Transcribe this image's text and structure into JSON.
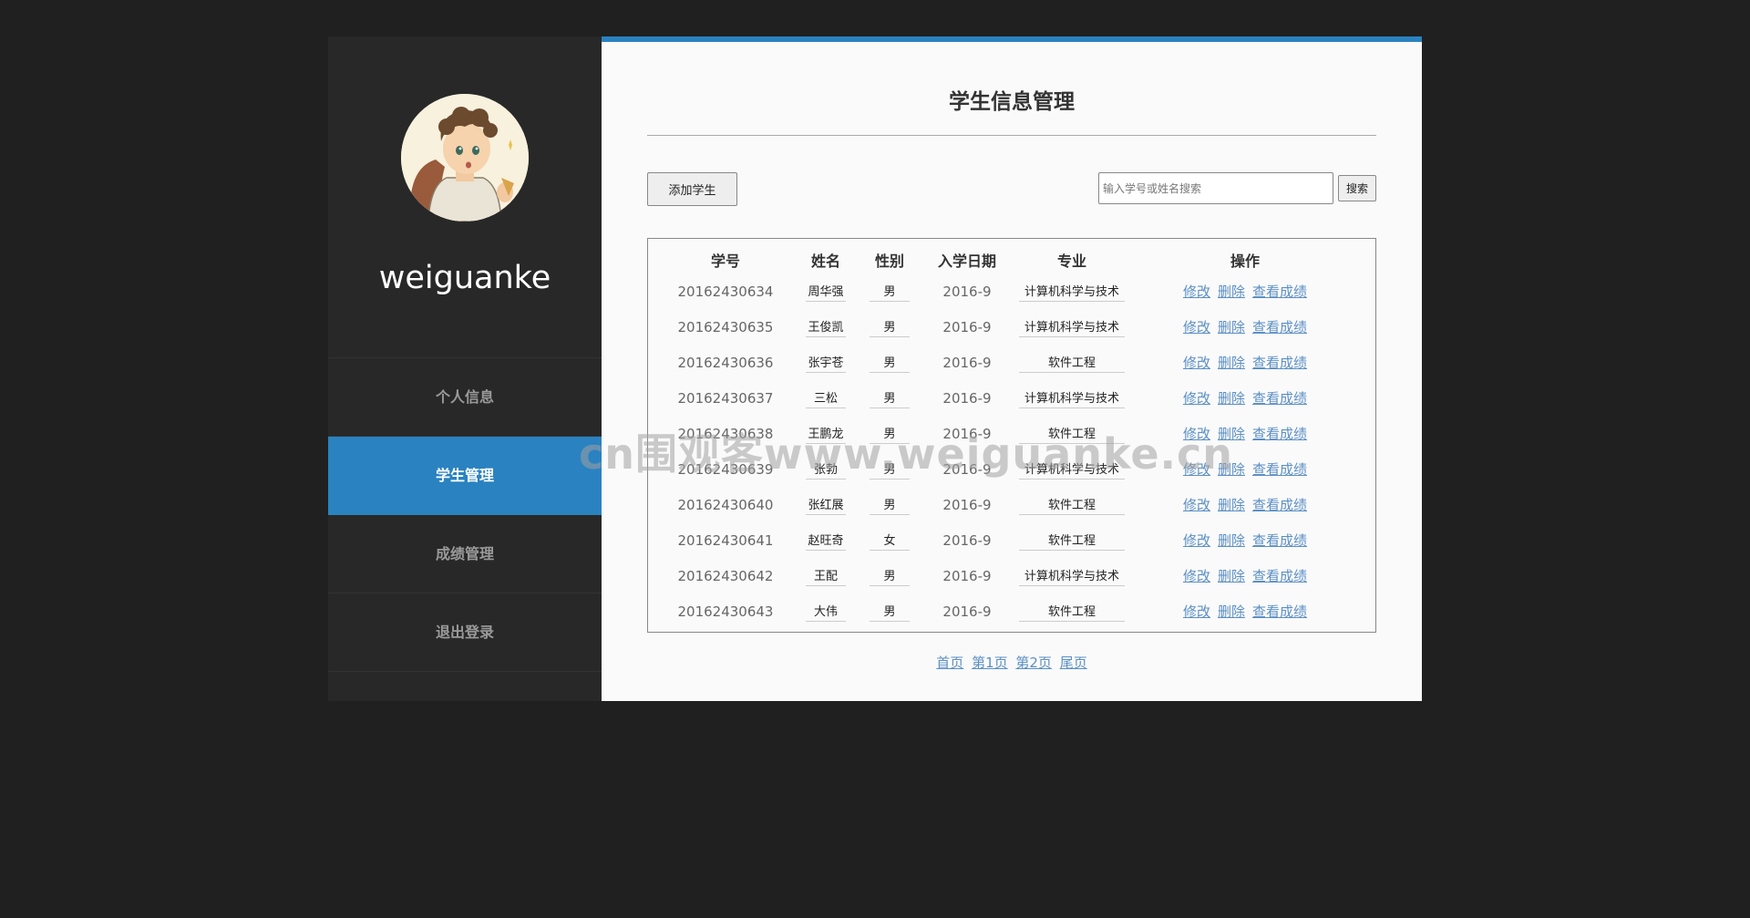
{
  "sidebar": {
    "username": "weiguanke",
    "nav": [
      {
        "label": "个人信息",
        "active": false
      },
      {
        "label": "学生管理",
        "active": true
      },
      {
        "label": "成绩管理",
        "active": false
      },
      {
        "label": "退出登录",
        "active": false
      }
    ]
  },
  "main": {
    "title": "学生信息管理",
    "add_button": "添加学生",
    "search": {
      "placeholder": "输入学号或姓名搜索",
      "button": "搜索"
    },
    "table": {
      "columns": [
        "学号",
        "姓名",
        "性别",
        "入学日期",
        "专业",
        "操作"
      ],
      "rows": [
        {
          "id": "20162430634",
          "name": "周华强",
          "gender": "男",
          "date": "2016-9",
          "major": "计算机科学与技术"
        },
        {
          "id": "20162430635",
          "name": "王俊凯",
          "gender": "男",
          "date": "2016-9",
          "major": "计算机科学与技术"
        },
        {
          "id": "20162430636",
          "name": "张宇苍",
          "gender": "男",
          "date": "2016-9",
          "major": "软件工程"
        },
        {
          "id": "20162430637",
          "name": "三松",
          "gender": "男",
          "date": "2016-9",
          "major": "计算机科学与技术"
        },
        {
          "id": "20162430638",
          "name": "王鹏龙",
          "gender": "男",
          "date": "2016-9",
          "major": "软件工程"
        },
        {
          "id": "20162430639",
          "name": "张勃",
          "gender": "男",
          "date": "2016-9",
          "major": "计算机科学与技术"
        },
        {
          "id": "20162430640",
          "name": "张红展",
          "gender": "男",
          "date": "2016-9",
          "major": "软件工程"
        },
        {
          "id": "20162430641",
          "name": "赵旺奇",
          "gender": "女",
          "date": "2016-9",
          "major": "软件工程"
        },
        {
          "id": "20162430642",
          "name": "王配",
          "gender": "男",
          "date": "2016-9",
          "major": "计算机科学与技术"
        },
        {
          "id": "20162430643",
          "name": "大伟",
          "gender": "男",
          "date": "2016-9",
          "major": "软件工程"
        }
      ],
      "actions": [
        "修改",
        "删除",
        "查看成绩"
      ]
    },
    "pagination": [
      "首页",
      "第1页",
      "第2页",
      "尾页"
    ]
  },
  "watermark": "cn围观客www.weiguanke.cn",
  "colors": {
    "accent": "#2a82c0",
    "sidebar": "#282828",
    "page_bg": "#202020",
    "link": "#5b8fc4"
  }
}
